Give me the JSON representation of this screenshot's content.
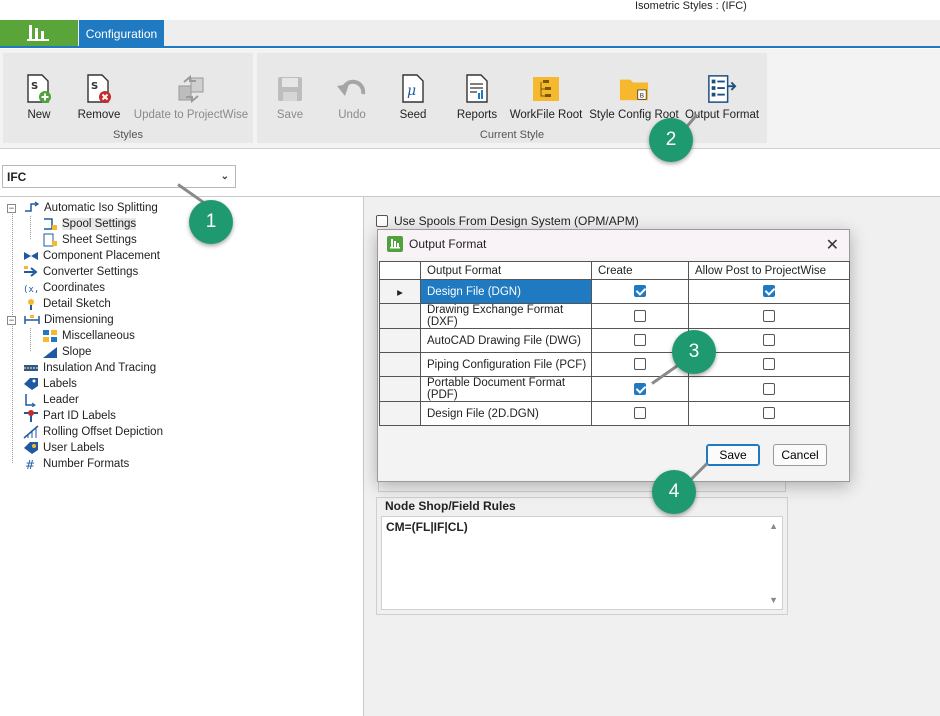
{
  "window": {
    "title": "Isometric Styles : (IFC)"
  },
  "tabs": {
    "active": "Configuration"
  },
  "ribbon": {
    "groups": [
      {
        "label": "Styles",
        "buttons": [
          "New",
          "Remove",
          "Update to ProjectWise"
        ]
      },
      {
        "label": "Current Style",
        "buttons": [
          "Save",
          "Undo",
          "Seed",
          "Reports",
          "WorkFile Root",
          "Style Config Root",
          "Output Format"
        ]
      }
    ],
    "disabled_buttons": [
      "Update to ProjectWise",
      "Save",
      "Undo"
    ]
  },
  "style_select": {
    "value": "IFC"
  },
  "tree": {
    "items": [
      {
        "label": "Automatic Iso Splitting",
        "icon": "split-icon"
      },
      {
        "label": "Spool Settings",
        "icon": "spool-icon",
        "selected": true
      },
      {
        "label": "Sheet Settings",
        "icon": "sheet-icon"
      },
      {
        "label": "Component Placement",
        "icon": "valve-icon"
      },
      {
        "label": "Converter Settings",
        "icon": "converter-icon"
      },
      {
        "label": "Coordinates",
        "icon": "coordinates-icon"
      },
      {
        "label": "Detail Sketch",
        "icon": "detail-icon"
      },
      {
        "label": "Dimensioning",
        "icon": "dimension-icon"
      },
      {
        "label": "Miscellaneous",
        "icon": "misc-icon"
      },
      {
        "label": "Slope",
        "icon": "slope-icon"
      },
      {
        "label": "Insulation And Tracing",
        "icon": "insulation-icon"
      },
      {
        "label": "Labels",
        "icon": "tag-icon"
      },
      {
        "label": "Leader",
        "icon": "leader-icon"
      },
      {
        "label": "Part ID Labels",
        "icon": "partid-icon"
      },
      {
        "label": "Rolling Offset Depiction",
        "icon": "rolling-icon"
      },
      {
        "label": "User Labels",
        "icon": "userlabel-icon"
      },
      {
        "label": "Number Formats",
        "icon": "hash-icon"
      }
    ]
  },
  "right_panel": {
    "use_spools_label": "Use Spools From Design System (OPM/APM)",
    "node_rules": {
      "title": "Node Shop/Field Rules",
      "value": "CM=(FL|IF|CL)"
    }
  },
  "dialog": {
    "title": "Output Format",
    "columns": [
      "Output Format",
      "Create",
      "Allow Post to ProjectWise"
    ],
    "rows": [
      {
        "name": "Design File (DGN)",
        "create": true,
        "allow_post": true,
        "selected": true
      },
      {
        "name": "Drawing Exchange Format (DXF)",
        "create": false,
        "allow_post": false
      },
      {
        "name": "AutoCAD Drawing File (DWG)",
        "create": false,
        "allow_post": false
      },
      {
        "name": "Piping Configuration File (PCF)",
        "create": false,
        "allow_post": false
      },
      {
        "name": "Portable Document Format (PDF)",
        "create": true,
        "allow_post": false
      },
      {
        "name": "Design File (2D.DGN)",
        "create": false,
        "allow_post": false
      }
    ],
    "save_label": "Save",
    "cancel_label": "Cancel"
  },
  "callouts": [
    "1",
    "2",
    "3",
    "4"
  ],
  "colors": {
    "accent": "#1f7ac1",
    "callout": "#1f9a70",
    "brand": "#5aa53a"
  }
}
